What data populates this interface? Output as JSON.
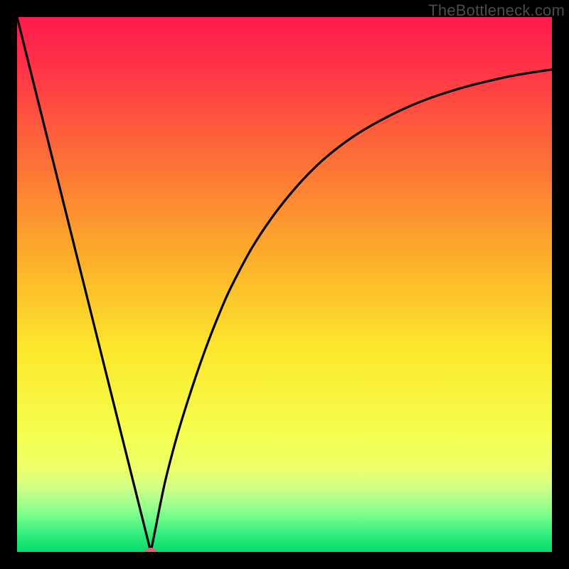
{
  "watermark": "TheBottleneck.com",
  "chart_data": {
    "type": "line",
    "title": "",
    "xlabel": "",
    "ylabel": "",
    "xlim": [
      0,
      100
    ],
    "ylim": [
      0,
      100
    ],
    "optimal_x": 25,
    "series": [
      {
        "name": "bottleneck-curve",
        "x": [
          0,
          2,
          4,
          6,
          8,
          10,
          12,
          14,
          16,
          18,
          20,
          22,
          23,
          24,
          25,
          26,
          27,
          28,
          30,
          32,
          34,
          36,
          38,
          40,
          44,
          48,
          52,
          56,
          60,
          64,
          68,
          72,
          76,
          80,
          84,
          88,
          92,
          96,
          100
        ],
        "y": [
          100,
          92,
          84,
          76,
          68,
          60,
          52,
          44,
          36,
          28,
          20,
          12,
          8,
          4,
          0,
          5,
          10,
          14.5,
          22,
          28.5,
          34.5,
          40,
          45,
          49.5,
          57,
          63,
          68,
          72.2,
          75.6,
          78.4,
          80.7,
          82.7,
          84.4,
          85.8,
          87,
          88,
          88.9,
          89.6,
          90.2
        ]
      }
    ],
    "marker": {
      "x": 25,
      "y": 0,
      "color": "#d36a6f",
      "rx": 9,
      "ry": 6
    },
    "gradient_stops": [
      {
        "offset": 0.0,
        "color": "#ff1a4d"
      },
      {
        "offset": 0.1,
        "color": "#ff3547"
      },
      {
        "offset": 0.25,
        "color": "#fd6a38"
      },
      {
        "offset": 0.45,
        "color": "#fcae2a"
      },
      {
        "offset": 0.62,
        "color": "#fde72c"
      },
      {
        "offset": 0.78,
        "color": "#f4ff4e"
      },
      {
        "offset": 0.845,
        "color": "#ecff68"
      },
      {
        "offset": 0.865,
        "color": "#dfff7a"
      },
      {
        "offset": 0.885,
        "color": "#c8ff88"
      },
      {
        "offset": 0.905,
        "color": "#aaff8e"
      },
      {
        "offset": 0.925,
        "color": "#85ff8d"
      },
      {
        "offset": 0.945,
        "color": "#5cf886"
      },
      {
        "offset": 0.965,
        "color": "#36ee7d"
      },
      {
        "offset": 0.985,
        "color": "#17e374"
      },
      {
        "offset": 1.0,
        "color": "#07db6e"
      }
    ]
  }
}
